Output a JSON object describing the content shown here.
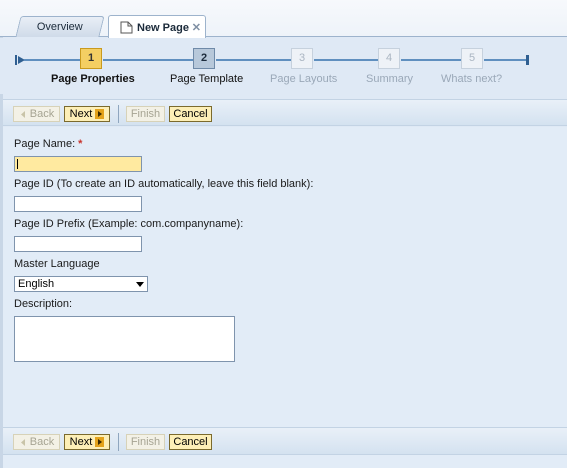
{
  "tabs": [
    {
      "label": "Overview"
    },
    {
      "label": "New Page",
      "close_icon": "close-x-icon"
    }
  ],
  "wizard": {
    "steps": [
      {
        "number": "1",
        "label": "Page Properties",
        "state": "active"
      },
      {
        "number": "2",
        "label": "Page Template",
        "state": "next"
      },
      {
        "number": "3",
        "label": "Page Layouts",
        "state": "disabled"
      },
      {
        "number": "4",
        "label": "Summary",
        "state": "disabled"
      },
      {
        "number": "5",
        "label": "Whats next?",
        "state": "disabled"
      }
    ]
  },
  "toolbar": {
    "back_label": "Back",
    "next_label": "Next",
    "finish_label": "Finish",
    "cancel_label": "Cancel"
  },
  "form": {
    "page_name_label": "Page Name:",
    "required_marker": "*",
    "page_name_value": "",
    "page_id_label": "Page ID (To create an ID automatically, leave this field blank):",
    "page_id_value": "",
    "page_id_prefix_label": "Page ID Prefix (Example: com.companyname):",
    "page_id_prefix_value": "",
    "master_language_label": "Master Language",
    "master_language_value": "English",
    "description_label": "Description:",
    "description_value": ""
  },
  "colors": {
    "active_step": "#f4cf63",
    "required_field": "#ffeaa0",
    "required_marker": "#c8322b",
    "background": "#dfe9f5"
  }
}
